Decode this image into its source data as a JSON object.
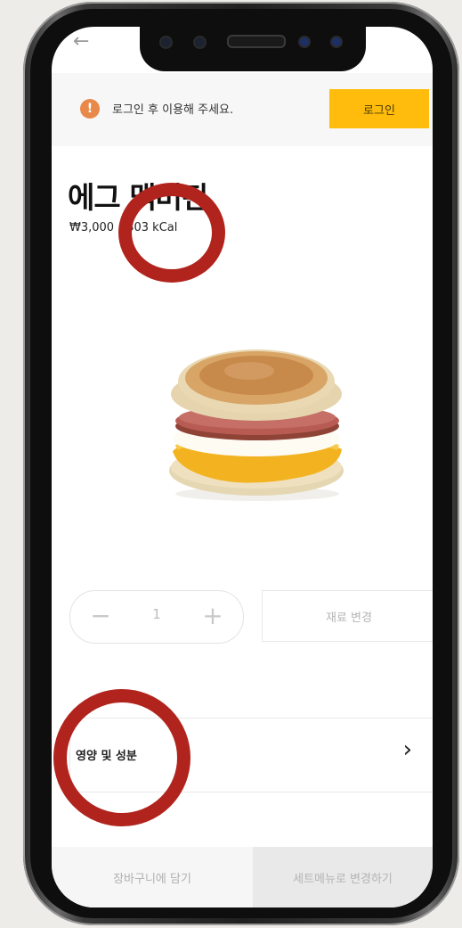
{
  "nav": {
    "back_icon": "arrow-left-icon"
  },
  "login_banner": {
    "icon": "alert-circle-icon",
    "message": "로그인 후 이용해 주세요.",
    "button_label": "로그인"
  },
  "product": {
    "name": "에그 맥머핀",
    "price": "₩3,000",
    "calories": "303 kCal",
    "image_icon": "egg-mcmuffin-image"
  },
  "quantity": {
    "minus_icon": "minus-icon",
    "value": "1",
    "plus_icon": "plus-icon"
  },
  "change_ingredients_label": "재료 변경",
  "nutrition": {
    "label": "영양 및 성분",
    "icon": "chevron-right-icon"
  },
  "bottom_bar": {
    "cart_label": "장바구니에 담기",
    "set_menu_label": "세트메뉴로 변경하기"
  },
  "colors": {
    "accent": "#ffbc0d",
    "alert": "#e8894a",
    "annotation": "#b1241d"
  }
}
